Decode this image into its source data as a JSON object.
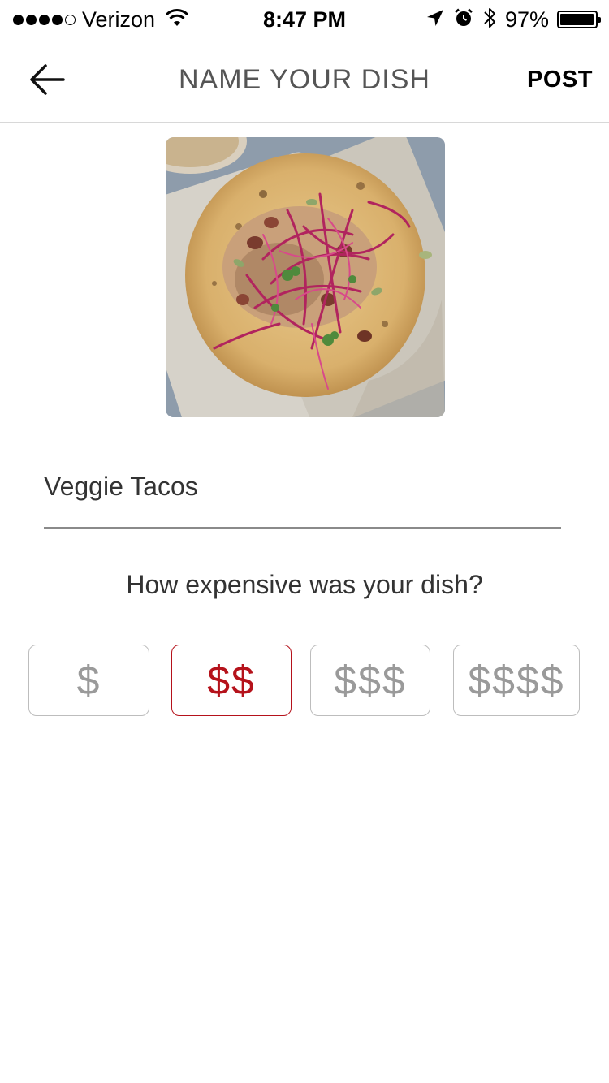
{
  "status_bar": {
    "carrier": "Verizon",
    "time": "8:47 PM",
    "battery_percent": "97%",
    "battery_level": 0.97,
    "signal_bars_filled": 4,
    "signal_bars_total": 5
  },
  "nav": {
    "title": "NAME YOUR DISH",
    "post_label": "POST"
  },
  "dish": {
    "name_value": "Veggie Tacos"
  },
  "price": {
    "question": "How expensive was your dish?",
    "options": [
      "$",
      "$$",
      "$$$",
      "$$$$"
    ],
    "selected_index": 1
  },
  "colors": {
    "accent": "#b5121b",
    "inactive": "#9a9a9a",
    "divider": "#d8d8d8"
  },
  "icons": {
    "back": "arrow-left-icon",
    "wifi": "wifi-icon",
    "location": "location-arrow-icon",
    "alarm": "alarm-clock-icon",
    "bluetooth": "bluetooth-icon",
    "battery": "battery-icon"
  }
}
